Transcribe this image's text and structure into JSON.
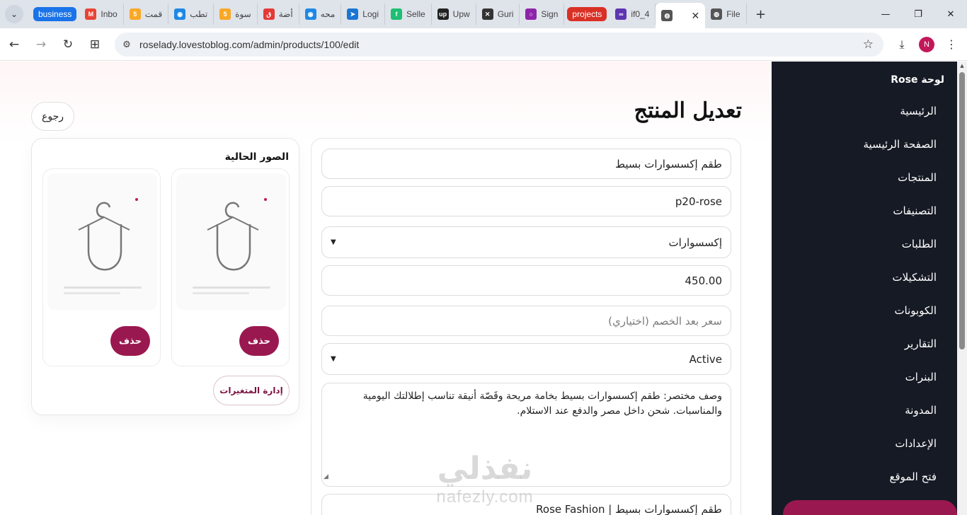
{
  "browser": {
    "tabs": [
      {
        "label": "business",
        "type": "group",
        "color": "#1a73e8"
      },
      {
        "label": "Inbo",
        "icon": "gmail-icon",
        "color": "#ea4335"
      },
      {
        "label": "قمت",
        "icon": "five-icon",
        "color": "#f9a825"
      },
      {
        "label": "تطب",
        "icon": "circle-icon",
        "color": "#1e88e5"
      },
      {
        "label": "سوة",
        "icon": "five-icon",
        "color": "#f9a825"
      },
      {
        "label": "أضة",
        "icon": "mostaql-icon",
        "color": "#e53935"
      },
      {
        "label": "محه",
        "icon": "circle-icon",
        "color": "#1e88e5"
      },
      {
        "label": "Logi",
        "icon": "plane-icon",
        "color": "#1976d2"
      },
      {
        "label": "Selle",
        "icon": "fiverr-icon",
        "color": "#1dbf73"
      },
      {
        "label": "Upw",
        "icon": "upwork-icon",
        "color": "#222222"
      },
      {
        "label": "Guri",
        "icon": "ninja-icon",
        "color": "#333333"
      },
      {
        "label": "Sign",
        "icon": "ring-icon",
        "color": "#8e24aa"
      },
      {
        "label": "projects",
        "type": "group",
        "color": "#d93025"
      },
      {
        "label": "if0_4",
        "icon": "infinity-icon",
        "color": "#5e35b1"
      },
      {
        "label": "",
        "icon": "globe-icon",
        "color": "#555555",
        "active": true
      },
      {
        "label": "File",
        "icon": "globe-icon",
        "color": "#555555"
      }
    ],
    "url": "roselady.lovestoblog.com/admin/products/100/edit",
    "profile_initial": "N"
  },
  "sidebar": {
    "brand": "لوحة Rose",
    "items": [
      "الرئيسية",
      "الصفحة الرئيسية",
      "المنتجات",
      "التصنيفات",
      "الطلبات",
      "التشكيلات",
      "الكوبونات",
      "التقارير",
      "البنرات",
      "المدونة",
      "الإعدادات",
      "فتح الموقع"
    ]
  },
  "page": {
    "title": "تعديل المنتج",
    "back_label": "رجوع"
  },
  "form": {
    "name": "طقم إكسسوارات بسيط",
    "sku": "p20-rose",
    "category": "إكسسوارات",
    "price": "450.00",
    "sale_price_placeholder": "سعر بعد الخصم (اختياري)",
    "status": "Active",
    "description": "وصف مختصر: طقم إكسسوارات بسيط بخامة مريحة وقَصّة أنيقة تناسب إطلالتك اليومية والمناسبات. شحن داخل مصر والدفع عند الاستلام.",
    "seo_title": "طقم إكسسوارات بسيط | Rose Fashion"
  },
  "images": {
    "title": "الصور الحالية",
    "delete_label": "حذف",
    "variants_label": "إدارة المتغيرات",
    "count": 2
  },
  "watermark": {
    "arabic": "نفذلي",
    "latin": "nafezly.com"
  },
  "colors": {
    "sidebar_bg": "#161a25",
    "accent": "#9a1850"
  }
}
